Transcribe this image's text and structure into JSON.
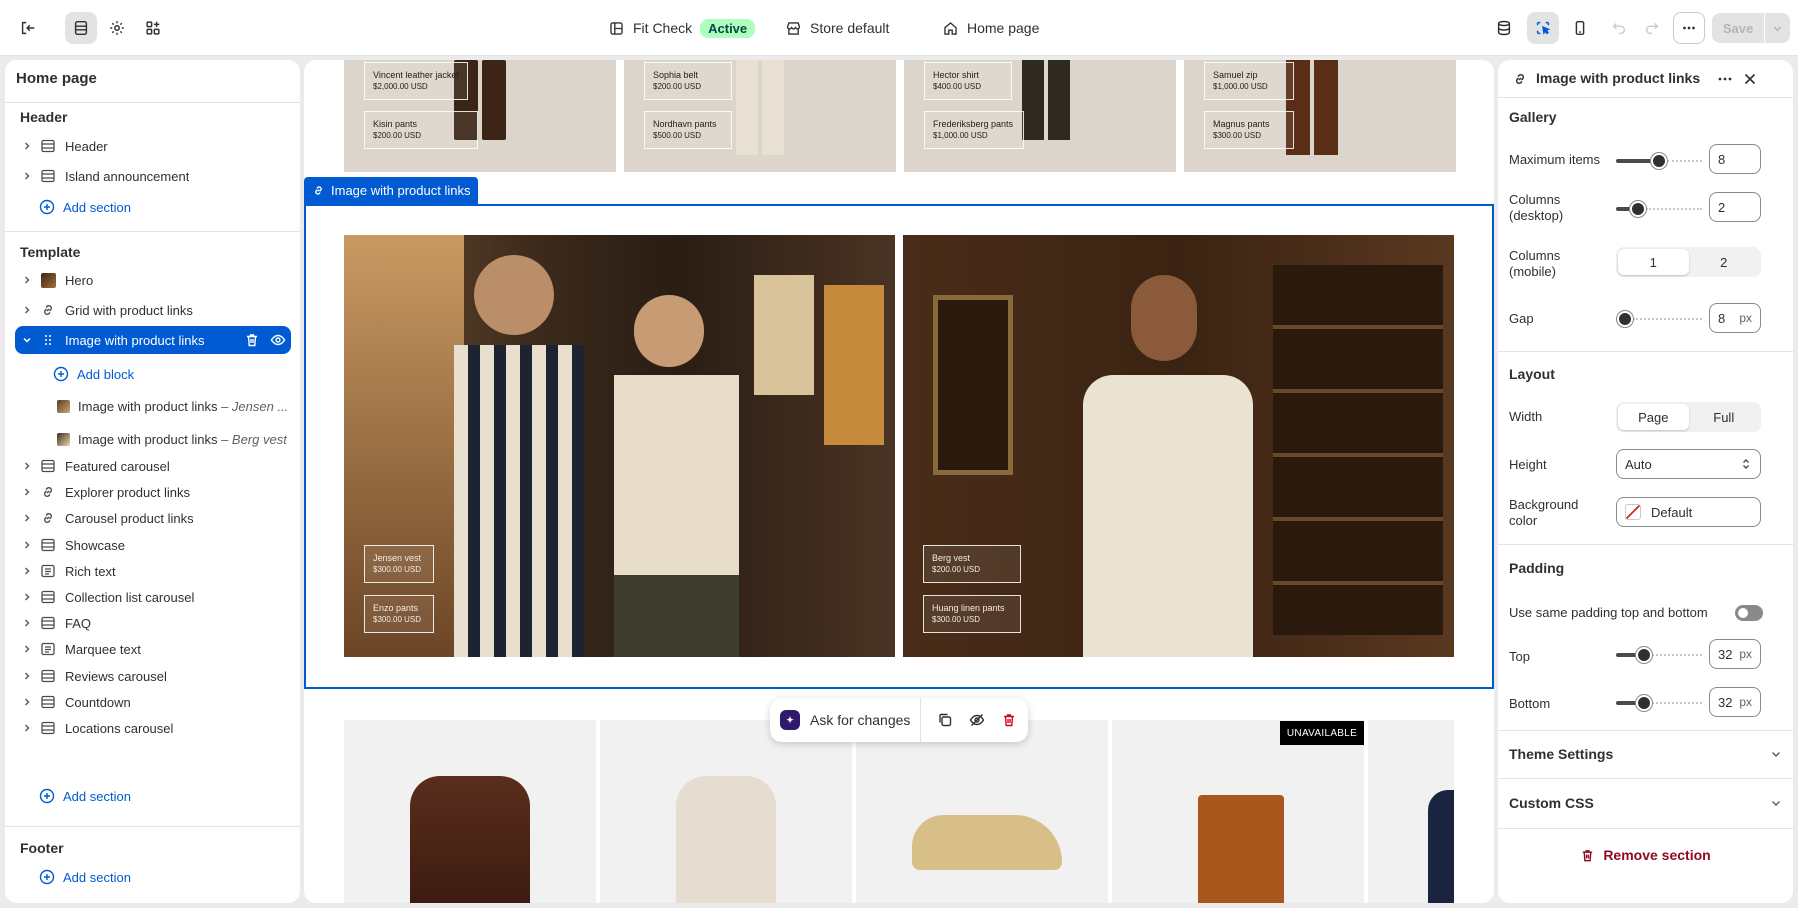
{
  "topbar": {
    "app_name": "Fit Check",
    "status_badge": "Active",
    "store_name": "Store default",
    "page_name": "Home page",
    "save_label": "Save"
  },
  "left": {
    "page_title": "Home page",
    "header_group": "Header",
    "header_items": [
      {
        "label": "Header",
        "icon": "layout-icon"
      },
      {
        "label": "Island announcement",
        "icon": "layout-icon"
      }
    ],
    "add_section": "Add section",
    "template_group": "Template",
    "template_items": [
      {
        "label": "Hero",
        "icon": "image-icon"
      },
      {
        "label": "Grid with product links",
        "icon": "link-icon"
      },
      {
        "label": "Image with product links",
        "icon": "drag-handle-icon"
      },
      {
        "label": "Featured carousel",
        "icon": "layout-icon"
      },
      {
        "label": "Explorer product links",
        "icon": "link-icon"
      },
      {
        "label": "Carousel product links",
        "icon": "link-icon"
      },
      {
        "label": "Showcase",
        "icon": "layout-icon"
      },
      {
        "label": "Rich text",
        "icon": "text-icon"
      },
      {
        "label": "Collection list carousel",
        "icon": "layout-icon"
      },
      {
        "label": "FAQ",
        "icon": "layout-icon"
      },
      {
        "label": "Marquee text",
        "icon": "text-icon"
      },
      {
        "label": "Reviews carousel",
        "icon": "layout-icon"
      },
      {
        "label": "Countdown",
        "icon": "layout-icon"
      },
      {
        "label": "Locations carousel",
        "icon": "layout-icon"
      }
    ],
    "add_block": "Add block",
    "blocks": [
      {
        "label": "Image with product links",
        "suffix": "– Jensen ..."
      },
      {
        "label": "Image with product links",
        "suffix": "– Berg vest"
      }
    ],
    "footer_group": "Footer"
  },
  "canvas": {
    "top_labels": [
      {
        "name": "Vincent leather jacket",
        "price": "$2,000.00 USD"
      },
      {
        "name": "Kisin pants",
        "price": "$200.00 USD"
      },
      {
        "name": "Sophia belt",
        "price": "$200.00 USD"
      },
      {
        "name": "Nordhavn pants",
        "price": "$500.00 USD"
      },
      {
        "name": "Hector shirt",
        "price": "$400.00 USD"
      },
      {
        "name": "Frederiksberg pants",
        "price": "$1,000.00 USD"
      },
      {
        "name": "Samuel zip",
        "price": "$1,000.00 USD"
      },
      {
        "name": "Magnus pants",
        "price": "$300.00 USD"
      }
    ],
    "selected_tag": "Image with product links",
    "main_labels": [
      {
        "name": "Jensen vest",
        "price": "$300.00 USD"
      },
      {
        "name": "Enzo pants",
        "price": "$300.00 USD"
      },
      {
        "name": "Berg vest",
        "price": "$200.00 USD"
      },
      {
        "name": "Huang linen pants",
        "price": "$300.00 USD"
      }
    ],
    "unavailable_badge": "UNAVAILABLE",
    "ask_label": "Ask for changes"
  },
  "right": {
    "title": "Image with product links",
    "gallery": {
      "title": "Gallery",
      "max_items_label": "Maximum items",
      "max_items": "8",
      "max_items_level": 0.5,
      "columns_desktop_label": "Columns (desktop)",
      "columns_desktop": "2",
      "columns_desktop_level": 0.25,
      "columns_mobile_label": "Columns (mobile)",
      "columns_mobile_options": [
        "1",
        "2"
      ],
      "columns_mobile_selected": "1",
      "gap_label": "Gap",
      "gap": "8",
      "gap_unit": "px",
      "gap_level": 0.1
    },
    "layout": {
      "title": "Layout",
      "width_label": "Width",
      "width_options": [
        "Page",
        "Full"
      ],
      "width_selected": "Page",
      "height_label": "Height",
      "height_value": "Auto",
      "bg_label": "Background color",
      "bg_value": "Default"
    },
    "padding": {
      "title": "Padding",
      "same_label": "Use same padding top and bottom",
      "same_on": false,
      "top_label": "Top",
      "top": "32",
      "top_level": 0.32,
      "bottom_label": "Bottom",
      "bottom": "32",
      "bottom_level": 0.32,
      "unit": "px"
    },
    "theme_settings": "Theme Settings",
    "custom_css": "Custom CSS",
    "remove_section": "Remove section"
  }
}
